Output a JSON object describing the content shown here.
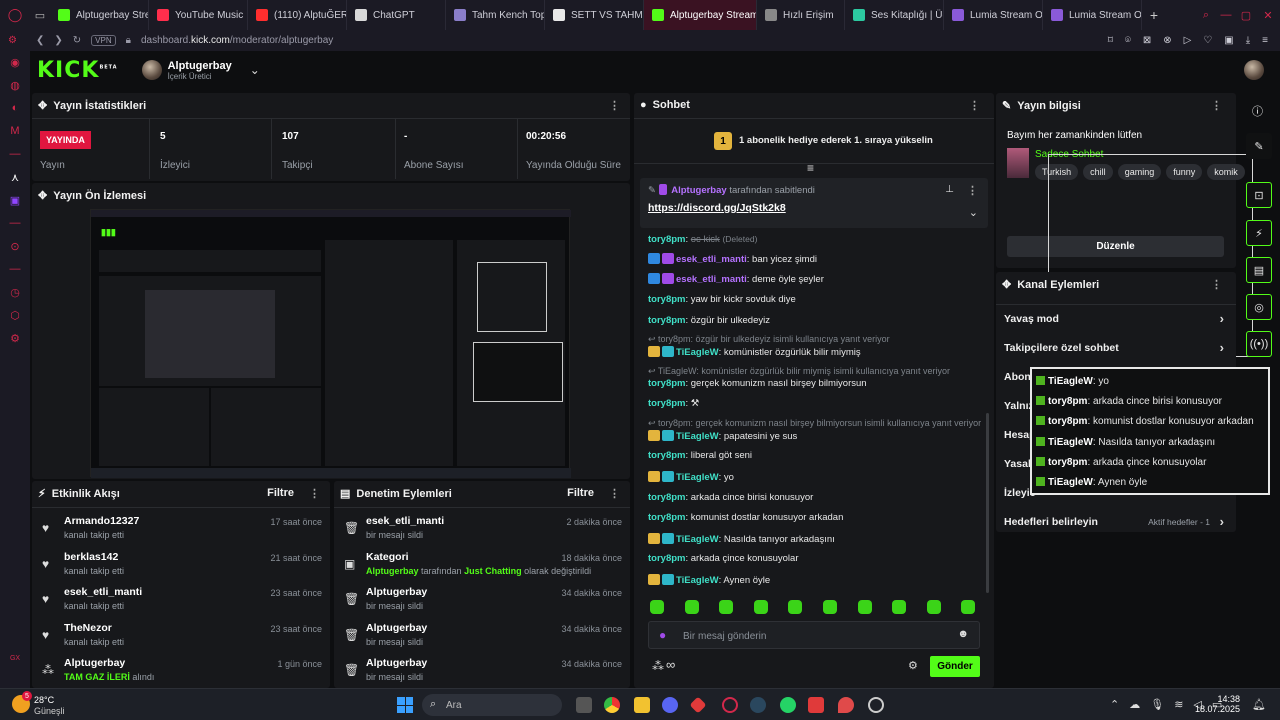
{
  "browser": {
    "tabs": [
      {
        "label": "Alptugerbay Strea",
        "color": "#53fc18"
      },
      {
        "label": "YouTube Music",
        "color": "#ff2e4c"
      },
      {
        "label": "(1110) AlptuĞERB/",
        "color": "#ff2e2e"
      },
      {
        "label": "ChatGPT",
        "color": "#d8d8d8"
      },
      {
        "label": "Tahm Kench Top",
        "color": "#8a7ec9"
      },
      {
        "label": "SETT VS TAHM K",
        "color": "#e8e8e8"
      },
      {
        "label": "Alptugerbay Stream - Kic",
        "color": "#53fc18"
      },
      {
        "label": "Hızlı Erişim",
        "color": "#888888"
      },
      {
        "label": "Ses Kitaplığı | Üc",
        "color": "#2cc9a0"
      },
      {
        "label": "Lumia Stream Ove",
        "color": "#8a5ad8"
      },
      {
        "label": "Lumia Stream Ove",
        "color": "#8a5ad8"
      }
    ],
    "active_tab_index": 6,
    "new_tab": "+",
    "vpn": "VPN",
    "url_prefix": "dashboard.",
    "url_host": "kick.com",
    "url_path": "/moderator/alptugerbay"
  },
  "header": {
    "logo": "KICK",
    "logo_sup": "BETA",
    "username": "Alptugerbay",
    "role": "İçerik Üretici"
  },
  "stats": {
    "title": "Yayın İstatistikleri",
    "live_badge": "YAYINDA",
    "items": [
      {
        "value": "",
        "label": "Yayın"
      },
      {
        "value": "5",
        "label": "İzleyici"
      },
      {
        "value": "107",
        "label": "Takipçi"
      },
      {
        "value": "-",
        "label": "Abone Sayısı"
      },
      {
        "value": "00:20:56",
        "label": "Yayında Olduğu Süre"
      }
    ]
  },
  "preview": {
    "title": "Yayın Ön İzlemesi"
  },
  "activity": {
    "title": "Etkinlik Akışı",
    "filter": "Filtre",
    "items": [
      {
        "name": "Armando12327",
        "sub": "kanalı takip etti",
        "time": "17 saat önce"
      },
      {
        "name": "berklas142",
        "sub": "kanalı takip etti",
        "time": "21 saat önce"
      },
      {
        "name": "esek_etli_manti",
        "sub": "kanalı takip etti",
        "time": "23 saat önce"
      },
      {
        "name": "TheNezor",
        "sub": "kanalı takip etti",
        "time": "23 saat önce"
      },
      {
        "name": "Alptugerbay",
        "sub": "TAM GAZ İLERİ",
        "sub2": " alındı",
        "time": "1 gün önce"
      }
    ]
  },
  "moderation": {
    "title": "Denetim Eylemleri",
    "filter": "Filtre",
    "items": [
      {
        "name": "esek_etli_manti",
        "sub": "bir mesajı sildi",
        "time": "2 dakika önce"
      },
      {
        "name": "Kategori",
        "sub_user": "Alptugerbay",
        "sub_mid": " tarafından ",
        "sub_cat": "Just Chatting",
        "sub_end": " olarak değiştirildi",
        "time": "18 dakika önce"
      },
      {
        "name": "Alptugerbay",
        "sub": "bir mesajı sildi",
        "time": "34 dakika önce"
      },
      {
        "name": "Alptugerbay",
        "sub": "bir mesajı sildi",
        "time": "34 dakika önce"
      },
      {
        "name": "Alptugerbay",
        "sub": "bir mesajı sildi",
        "time": "34 dakika önce"
      }
    ]
  },
  "chat": {
    "title": "Sohbet",
    "gift_count": "1",
    "gift_text": "1 abonelik hediye ederek 1. sıraya yükselin",
    "pinned_by": "Alptugerbay",
    "pinned_suffix": "tarafından sabitlendi",
    "pinned_link": "https://discord.gg/JqStk2k8",
    "deleted_user": "tory8pm",
    "deleted_text": "oc kick",
    "deleted_tag": "(Deleted)",
    "messages": [
      {
        "user": "esek_etli_manti",
        "text": "ban yicez şimdi"
      },
      {
        "user": "esek_etli_manti",
        "text": "deme öyle şeyler"
      },
      {
        "user": "tory8pm",
        "text": "yaw bir kickr sovduk diye"
      },
      {
        "user": "tory8pm",
        "text": "özgür bir ulkedeyiz"
      },
      {
        "reply": "tory8pm: özgür bir ulkedeyiz isimli kullanıcıya yanıt veriyor"
      },
      {
        "user": "TiEagleW",
        "text": "komünistler özgürlük bilir miymiş"
      },
      {
        "reply": "TiEagleW: komünistler özgürlük bilir miymiş isimli kullanıcıya yanıt veriyor"
      },
      {
        "user": "tory8pm",
        "text": "gerçek komunizm nasıl birşey bilmiyorsun"
      },
      {
        "user": "tory8pm",
        "text": "⚒"
      },
      {
        "reply": "tory8pm: gerçek komunizm nasıl birşey bilmiyorsun isimli kullanıcıya yanıt veriyor"
      },
      {
        "user": "TiEagleW",
        "text": "papatesini ye sus"
      },
      {
        "user": "tory8pm",
        "text": "liberal göt seni"
      },
      {
        "user": "TiEagleW",
        "text": "yo"
      },
      {
        "user": "tory8pm",
        "text": "arkada cince birisi konusuyor"
      },
      {
        "user": "tory8pm",
        "text": "komunist dostlar konusuyor arkadan"
      },
      {
        "user": "TiEagleW",
        "text": "Nasılda tanıyor arkadaşını"
      },
      {
        "user": "tory8pm",
        "text": "arkada çince konusuyolar"
      },
      {
        "user": "TiEagleW",
        "text": "Aynen öyle"
      }
    ],
    "placeholder": "Bir mesaj gönderin",
    "send": "Gönder"
  },
  "stream_info": {
    "title": "Yayın bilgisi",
    "stream_title": "Bayım her zamankinden lütfen",
    "mode": "Sadece Sohbet",
    "tags": [
      "Turkish",
      "chill",
      "gaming",
      "funny",
      "komik"
    ],
    "edit": "Düzenle"
  },
  "channel_actions": {
    "title": "Kanal Eylemleri",
    "items": [
      {
        "label": "Yavaş mod"
      },
      {
        "label": "Takipçilere özel sohbet"
      },
      {
        "label": "Abone"
      },
      {
        "label": "Yalnız"
      },
      {
        "label": "Hesap"
      },
      {
        "label": "Yasak"
      },
      {
        "label": "İzleyic"
      },
      {
        "label": "Hedefleri belirleyin",
        "status": "Aktif hedefler - 1"
      }
    ]
  },
  "overlay": {
    "messages": [
      {
        "user": "TiEagleW",
        "text": "yo"
      },
      {
        "user": "tory8pm",
        "text": "arkada cince birisi konusuyor"
      },
      {
        "user": "tory8pm",
        "text": "komunist dostlar konusuyor arkadan"
      },
      {
        "user": "TiEagleW",
        "text": "Nasılda tanıyor arkadaşını"
      },
      {
        "user": "tory8pm",
        "text": "arkada çince konusuyolar"
      },
      {
        "user": "TiEagleW",
        "text": "Aynen öyle"
      }
    ]
  },
  "taskbar": {
    "weather_temp": "28°C",
    "weather_desc": "Güneşli",
    "weather_badge": "5",
    "search": "Ara",
    "time": "14:38",
    "date": "18.07.2025"
  },
  "colors": {
    "accent": "#53fc18",
    "live": "#e0163f",
    "panel": "#17181b"
  }
}
